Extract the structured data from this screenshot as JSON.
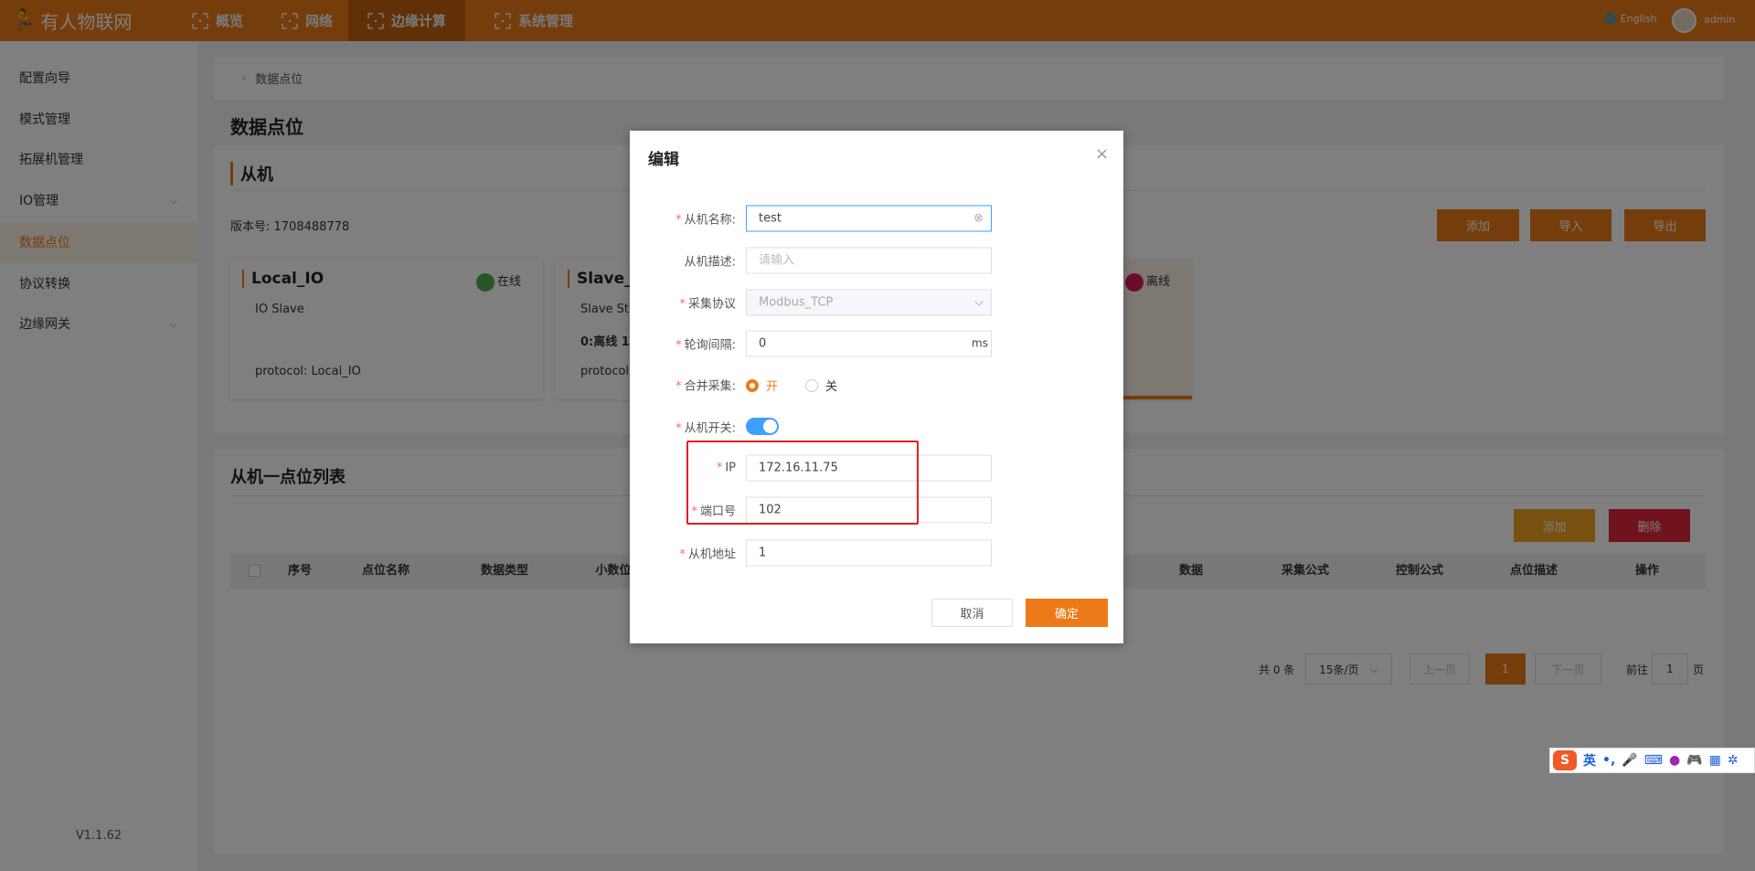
{
  "header": {
    "logo": "有人物联网",
    "nav": [
      {
        "label": "概览"
      },
      {
        "label": "网络"
      },
      {
        "label": "边缘计算",
        "active": true
      },
      {
        "label": "系统管理"
      }
    ],
    "language": "English",
    "user": "admin",
    "brand_color": "#ed7a18"
  },
  "sidebar": {
    "items": [
      {
        "label": "配置向导"
      },
      {
        "label": "模式管理"
      },
      {
        "label": "拓展机管理"
      },
      {
        "label": "IO管理",
        "chevron": true
      },
      {
        "label": "数据点位",
        "active": true
      },
      {
        "label": "协议转换"
      },
      {
        "label": "边缘网关",
        "chevron": true
      }
    ],
    "version": "V1.1.62"
  },
  "breadcrumb": {
    "current": "数据点位"
  },
  "page_title": "数据点位",
  "slave_section": {
    "title": "从机",
    "version_label": "版本号: 1708488778",
    "buttons": {
      "add": "添加",
      "import": "导入",
      "export": "导出"
    },
    "devices": [
      {
        "name": "Local_IO",
        "status": "在线",
        "desc": "IO Slave",
        "protocol": "protocol: Local_IO"
      },
      {
        "name": "Slave_",
        "status": "",
        "desc": "Slave St",
        "counts": "0:离线 1",
        "protocol": "protocol:"
      },
      {
        "name": "",
        "status": "离线"
      }
    ]
  },
  "points_section": {
    "title": "从机一点位列表",
    "buttons": {
      "add": "添加",
      "delete": "删除"
    },
    "columns": [
      "序号",
      "点位名称",
      "数据类型",
      "小数位",
      "数据",
      "采集公式",
      "控制公式",
      "点位描述",
      "操作"
    ],
    "pagination": {
      "total": "共 0 条",
      "page_size": "15条/页",
      "prev": "上一页",
      "current": "1",
      "next": "下一页",
      "goto_label": "前往",
      "goto_value": "1",
      "page_suffix": "页"
    }
  },
  "modal": {
    "title": "编辑",
    "fields": {
      "name": {
        "label": "从机名称:",
        "value": "test"
      },
      "desc": {
        "label": "从机描述:",
        "placeholder": "请输入"
      },
      "protocol": {
        "label": "采集协议",
        "value": "Modbus_TCP"
      },
      "interval": {
        "label": "轮询间隔:",
        "value": "0",
        "unit": "ms"
      },
      "merge": {
        "label": "合并采集:",
        "on": "开",
        "off": "关"
      },
      "switch": {
        "label": "从机开关:",
        "enabled": true
      },
      "ip": {
        "label": "IP",
        "value": "172.16.11.75"
      },
      "port": {
        "label": "端口号",
        "value": "102"
      },
      "address": {
        "label": "从机地址",
        "value": "1"
      }
    },
    "cancel": "取消",
    "confirm": "确定"
  },
  "ime": {
    "mode": "英",
    "punct": "•,"
  }
}
